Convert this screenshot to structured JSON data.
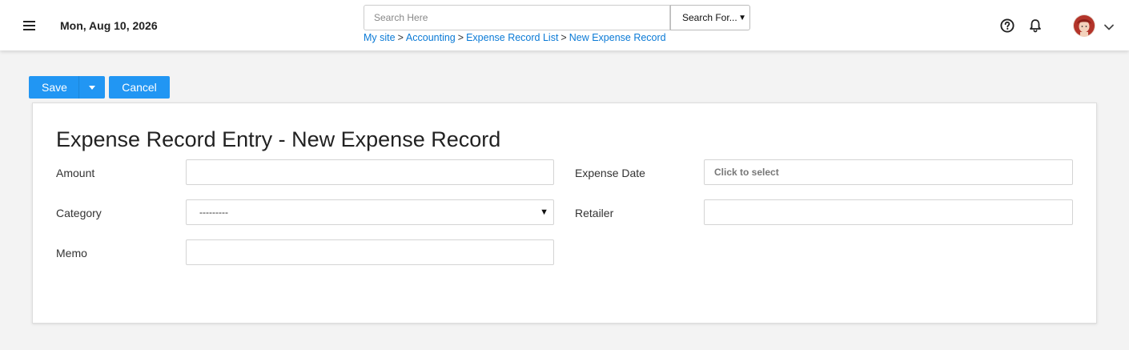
{
  "header": {
    "date": "Mon, Aug 10, 2026",
    "search": {
      "placeholder": "Search Here",
      "value": ""
    },
    "search_for": {
      "selected": "Search For..."
    },
    "breadcrumb": [
      "My site",
      "Accounting",
      "Expense Record List",
      "New Expense Record"
    ],
    "breadcrumb_separator": ">",
    "icons": {
      "menu": "hamburger-menu-icon",
      "help": "help-circle-icon",
      "notifications": "bell-icon",
      "user_menu": "chevron-down-icon"
    }
  },
  "toolbar": {
    "save_label": "Save",
    "cancel_label": "Cancel"
  },
  "form": {
    "title": "Expense Record Entry - New Expense Record",
    "amount_label": "Amount",
    "amount_value": "",
    "category_label": "Category",
    "category_selected": "---------",
    "memo_label": "Memo",
    "memo_value": "",
    "expense_date_label": "Expense Date",
    "expense_date_placeholder": "Click to select",
    "retailer_label": "Retailer",
    "retailer_value": ""
  },
  "colors": {
    "accent": "#2196f3",
    "link": "#0a7ad6",
    "background": "#f3f3f3"
  }
}
